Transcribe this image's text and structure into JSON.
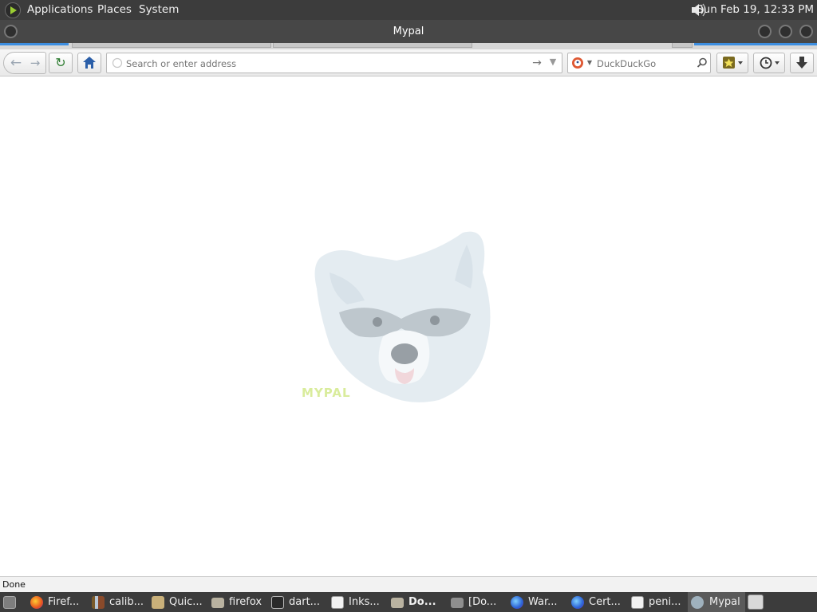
{
  "top_panel": {
    "menus": [
      "Applications",
      "Places",
      "System"
    ],
    "clock": "Sun Feb 19, 12:33 PM"
  },
  "window": {
    "title": "Mypal"
  },
  "navbar": {
    "url_placeholder": "Search or enter address",
    "search_engine": "DuckDuckGo"
  },
  "content": {
    "watermark": "MYPAL"
  },
  "statusbar": {
    "text": "Done"
  },
  "taskbar": {
    "items": [
      {
        "label": "Firef...",
        "icon": "firefox-icon"
      },
      {
        "label": "calib...",
        "icon": "calibre-icon"
      },
      {
        "label": "Quic...",
        "icon": "quickly-icon"
      },
      {
        "label": "firefox",
        "icon": "folder-icon"
      },
      {
        "label": "dart...",
        "icon": "terminal-icon"
      },
      {
        "label": "Inks...",
        "icon": "document-icon"
      },
      {
        "label": "Do...",
        "icon": "folder-icon"
      },
      {
        "label": "[Do...",
        "icon": "folder-icon"
      },
      {
        "label": "War...",
        "icon": "browser-icon"
      },
      {
        "label": "Cert...",
        "icon": "browser-icon"
      },
      {
        "label": "peni...",
        "icon": "window-icon"
      },
      {
        "label": "Mypal",
        "icon": "mypal-icon"
      }
    ]
  },
  "colors": {
    "panel_bg": "#3c3c3c",
    "titlebar_bg": "#474747",
    "accent": "#3d8ee0"
  }
}
